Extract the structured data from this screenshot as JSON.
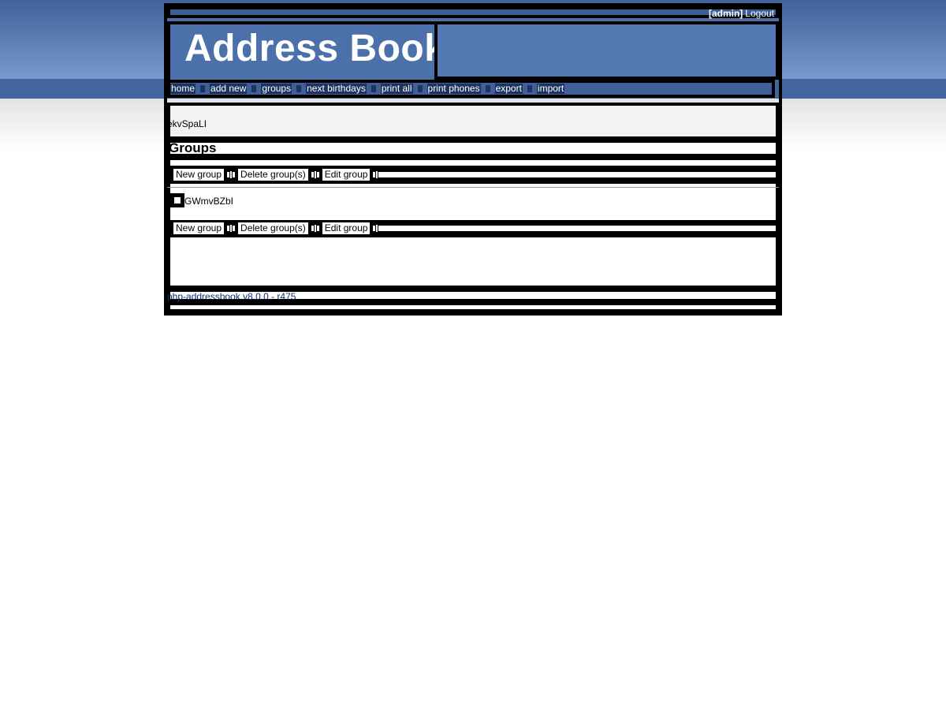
{
  "header": {
    "user_label": "[admin]",
    "logout_label": "Logout",
    "logo_text": "Address Book"
  },
  "nav": {
    "items": [
      {
        "label": "home"
      },
      {
        "label": "add new"
      },
      {
        "label": "groups"
      },
      {
        "label": "next birthdays"
      },
      {
        "label": "print all"
      },
      {
        "label": "print phones"
      },
      {
        "label": "export"
      },
      {
        "label": "import"
      }
    ]
  },
  "message": "ekvSpaLI",
  "page_title": "Groups",
  "buttons": {
    "new_group": "New group",
    "delete_groups": "Delete group(s)",
    "edit_group": "Edit group"
  },
  "groups": [
    {
      "name": "GWmvBZbI",
      "checked": false
    }
  ],
  "footer": {
    "version": "php-addressbook v8.0.0 - r475"
  },
  "colors": {
    "header_blue": "#41639a",
    "nav_blue": "#3e5f98",
    "footer_link": "#152c6b"
  }
}
